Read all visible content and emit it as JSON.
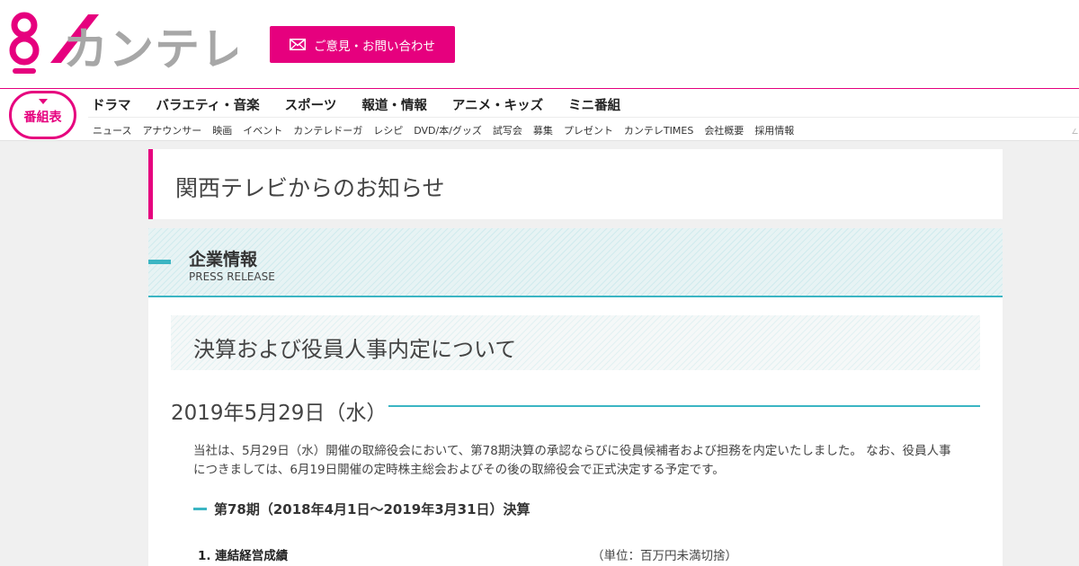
{
  "header": {
    "logo_text": "カンテレ",
    "contact_button_label": "ご意見・お問い合わせ",
    "brand_color": "#e6007e"
  },
  "nav": {
    "schedule_button_label": "番組表",
    "main_items": [
      "ドラマ",
      "バラエティ・音楽",
      "スポーツ",
      "報道・情報",
      "アニメ・キッズ",
      "ミニ番組"
    ],
    "sub_items": [
      "ニュース",
      "アナウンサー",
      "映画",
      "イベント",
      "カンテレドーガ",
      "レシピ",
      "DVD/本/グッズ",
      "試写会",
      "募集",
      "プレゼント",
      "カンテレTIMES",
      "会社概要",
      "採用情報"
    ]
  },
  "page": {
    "title": "関西テレビからのお知らせ"
  },
  "category": {
    "title_jp": "企業情報",
    "title_en": "PRESS RELEASE",
    "accent_color": "#3bb5c3"
  },
  "article": {
    "title": "決算および役員人事内定について",
    "date": "2019年5月29日（水）",
    "body": "当社は、5月29日（水）開催の取締役会において、第78期決算の承認ならびに役員候補者および担務を内定いたしました。 なお、役員人事につきましては、6月19日開催の定時株主総会およびその後の取締役会で正式決定する予定です。",
    "section_heading": "第78期（2018年4月1日～2019年3月31日）決算",
    "sub_heading": "1. 連結経営成績",
    "unit_note": "（単位：百万円未満切捨）"
  }
}
